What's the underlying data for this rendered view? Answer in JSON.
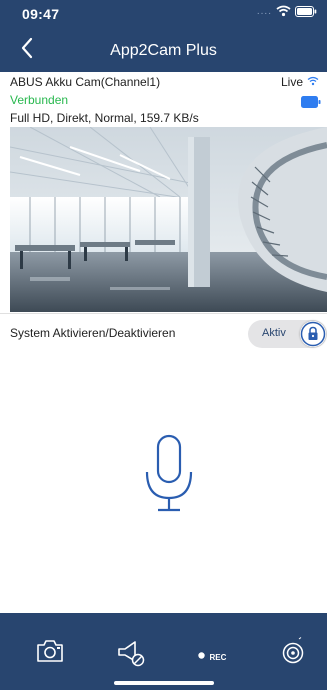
{
  "status_bar": {
    "time": "09:47",
    "dots": "....",
    "icons": [
      "wifi-icon",
      "battery-icon"
    ]
  },
  "nav": {
    "title": "App2Cam Plus",
    "back_icon": "chevron-left-icon"
  },
  "camera": {
    "name": "ABUS Akku Cam(Channel1)",
    "status": "Verbunden",
    "stream_info": "Full HD, Direkt, Normal, 159.7 KB/s",
    "live_label": "Live",
    "colors": {
      "connected": "#28b84e",
      "battery": "#2f7df0"
    }
  },
  "system": {
    "label": "System Aktivieren/Deaktivieren",
    "toggle_label": "Aktiv",
    "toggle_icon": "lock-icon"
  },
  "microphone": {
    "icon": "microphone-icon"
  },
  "toolbar": {
    "items": [
      {
        "icon": "camera-snapshot-icon"
      },
      {
        "icon": "siren-mute-icon"
      },
      {
        "icon": "record-icon",
        "label": "REC"
      },
      {
        "icon": "motion-sensor-icon"
      }
    ]
  },
  "colors": {
    "primary": "#28456f",
    "accent": "#2a5db0"
  }
}
